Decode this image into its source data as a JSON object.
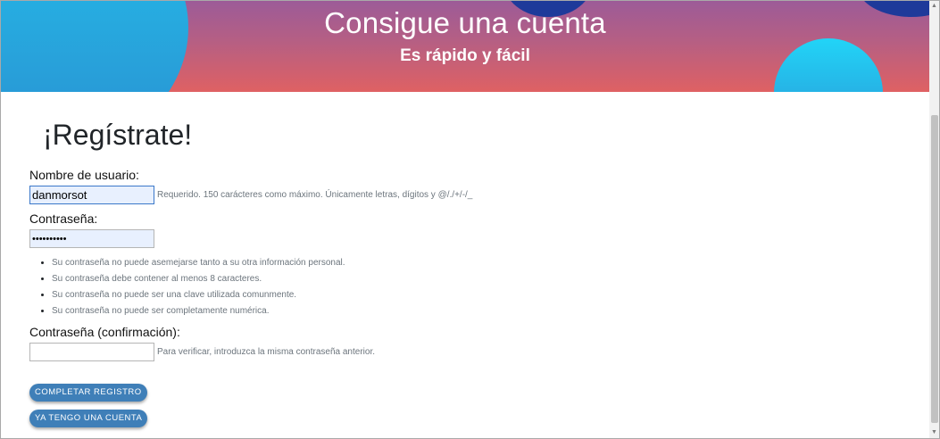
{
  "hero": {
    "title": "Consigue una cuenta",
    "subtitle": "Es rápido y fácil"
  },
  "form": {
    "title": "¡Regístrate!",
    "username": {
      "label": "Nombre de usuario:",
      "value": "danmorsot",
      "help": "Requerido. 150 carácteres como máximo. Únicamente letras, dígitos y @/./+/-/_"
    },
    "password": {
      "label": "Contraseña:",
      "value": "••••••••••",
      "rules": [
        "Su contraseña no puede asemejarse tanto a su otra información personal.",
        "Su contraseña debe contener al menos 8 caracteres.",
        "Su contraseña no puede ser una clave utilizada comunmente.",
        "Su contraseña no puede ser completamente numérica."
      ]
    },
    "password_confirm": {
      "label": "Contraseña (confirmación):",
      "value": "",
      "help": "Para verificar, introduzca la misma contraseña anterior."
    },
    "buttons": {
      "submit": "COMPLETAR REGISTRO",
      "login": "YA TENGO UNA CUENTA"
    }
  },
  "colors": {
    "hero_gradient_top": "#9c5b98",
    "hero_gradient_bottom": "#df6163",
    "blob_cyan": "#24c1ec",
    "blob_navy": "#1e3a9a",
    "button": "#3f7fb8",
    "help_text": "#6c757d"
  },
  "icons": {
    "scroll_up": "scroll-up-arrow-icon",
    "scroll_down": "scroll-down-arrow-icon"
  }
}
